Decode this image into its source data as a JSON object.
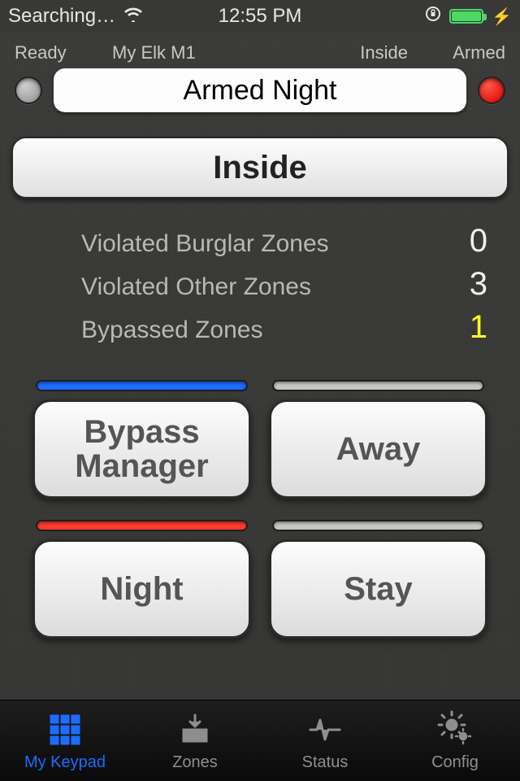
{
  "statusbar": {
    "carrier": "Searching…",
    "time": "12:55 PM"
  },
  "header": {
    "ready_label": "Ready",
    "device_name": "My Elk M1",
    "inside_label": "Inside",
    "armed_label": "Armed",
    "status_text": "Armed Night"
  },
  "mode_button": {
    "label": "Inside"
  },
  "zone_stats": {
    "rows": [
      {
        "label": "Violated Burglar Zones",
        "value": "0",
        "color": "white"
      },
      {
        "label": "Violated Other Zones",
        "value": "3",
        "color": "white"
      },
      {
        "label": "Bypassed Zones",
        "value": "1",
        "color": "yellow"
      }
    ]
  },
  "arm_buttons": {
    "bypass": {
      "label": "Bypass Manager",
      "pill": "blue"
    },
    "away": {
      "label": "Away",
      "pill": "grey"
    },
    "night": {
      "label": "Night",
      "pill": "red"
    },
    "stay": {
      "label": "Stay",
      "pill": "grey"
    }
  },
  "tabs": {
    "keypad": "My Keypad",
    "zones": "Zones",
    "status": "Status",
    "config": "Config"
  }
}
